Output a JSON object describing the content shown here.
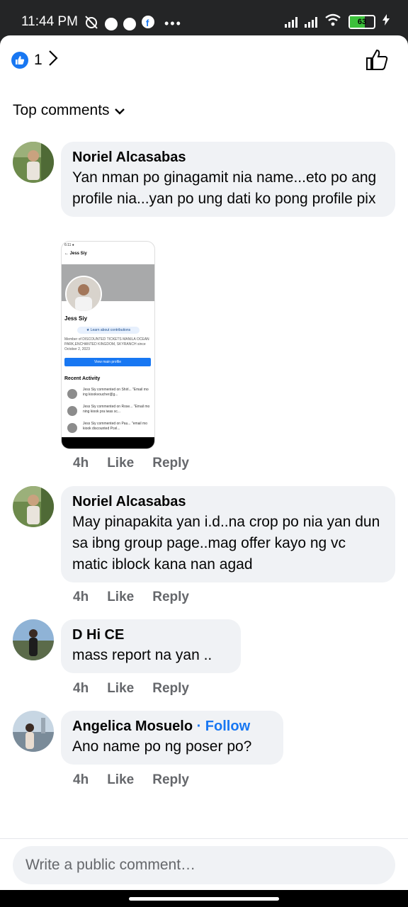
{
  "status_bar": {
    "time": "11:44 PM",
    "more": "•••",
    "battery": "63"
  },
  "header": {
    "like_count": "1",
    "sort_label": "Top comments"
  },
  "comments": [
    {
      "author": "Noriel Alcasabas",
      "text": "Yan nman po ginagamit nia name...eto po ang profile nia...yan po ung dati ko pong profile pix",
      "time": "4h",
      "like": "Like",
      "reply": "Reply"
    },
    {
      "author": "Noriel Alcasabas",
      "text": "May pinapakita yan i.d..na crop po nia yan dun sa ibng group page..mag offer kayo ng vc matic iblock kana nan agad",
      "time": "4h",
      "like": "Like",
      "reply": "Reply"
    },
    {
      "author": "D Hi CE",
      "text": "mass report na yan ..",
      "time": "4h",
      "like": "Like",
      "reply": "Reply"
    },
    {
      "author": "Angelica Mosuelo",
      "follow": "· Follow",
      "text": "Ano name po ng poser po?",
      "time": "4h",
      "like": "Like",
      "reply": "Reply"
    }
  ],
  "attachment": {
    "status": "6:11 ●",
    "back_title": "← Jess Siy",
    "name": "Jess Siy",
    "pill": "★ Learn about contributions",
    "desc": "Member of DISCOUNTED TICKETS MANILA OCEAN PARK,ENCHANTED KINGDOM, SKYRANCH since October 2, 2023",
    "button": "View main profile",
    "recent": "Recent Activity",
    "activity": [
      "Jess Siy commented on Shirl... \"Email mo ing kiookvoucher@g...",
      "Jess Siy commented on Rose... \"Email mo ning kiook pra iwas sc...",
      "Jess Siy commented on Pau... \"email mo kiook discounted Pcel..."
    ]
  },
  "composer": {
    "placeholder": "Write a public comment…"
  },
  "colors": {
    "accent": "#1877f2",
    "bubble": "#f0f2f5",
    "muted": "#65676b",
    "status_bg": "#242526"
  }
}
